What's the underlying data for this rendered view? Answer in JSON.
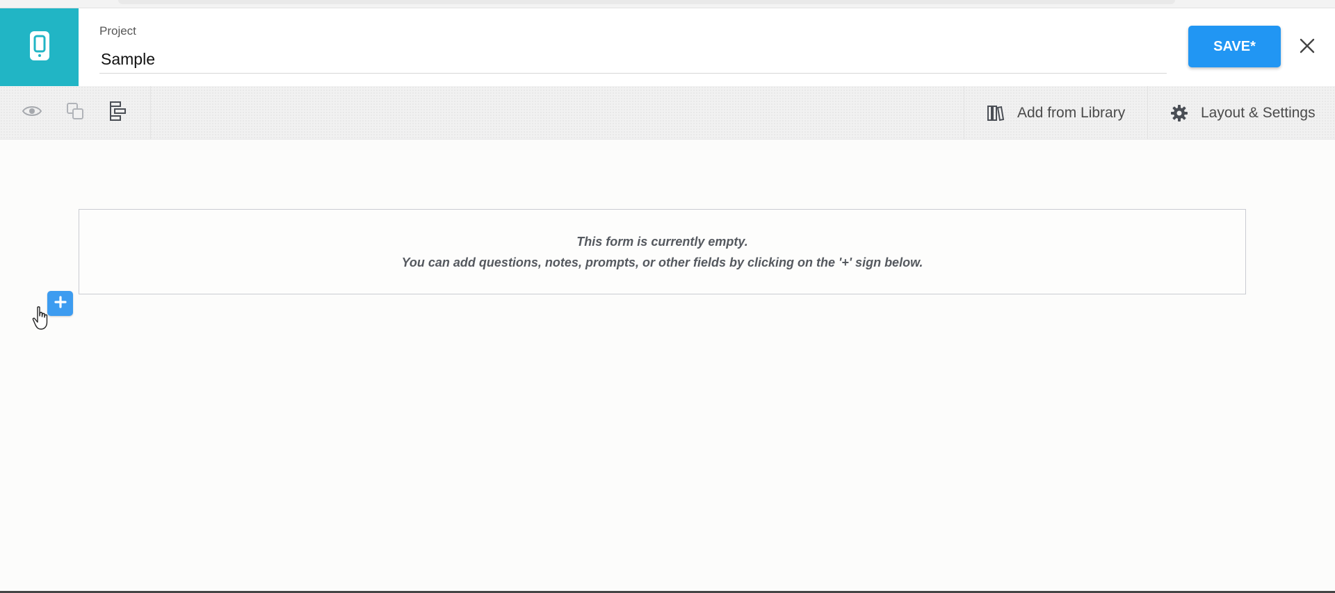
{
  "colors": {
    "brand_teal": "#21b5c5",
    "save_blue": "#2196f3",
    "add_blue": "#3d9cf0"
  },
  "header": {
    "app_icon": "mobile-device-icon",
    "project_label": "Project",
    "project_name": "Sample",
    "save_label": "SAVE*",
    "close_icon": "close-icon"
  },
  "toolbar": {
    "tools": [
      {
        "icon": "eye-icon",
        "title": "preview"
      },
      {
        "icon": "copy-icon",
        "title": "duplicate"
      },
      {
        "icon": "structure-icon",
        "title": "layout"
      }
    ],
    "actions": [
      {
        "icon": "library-icon",
        "label": "Add from Library"
      },
      {
        "icon": "gear-icon",
        "label": "Layout & Settings"
      }
    ]
  },
  "form": {
    "empty_title": "This form is currently empty.",
    "empty_hint": "You can add questions, notes, prompts, or other fields by clicking on the '+' sign below.",
    "add_icon": "plus-icon"
  }
}
